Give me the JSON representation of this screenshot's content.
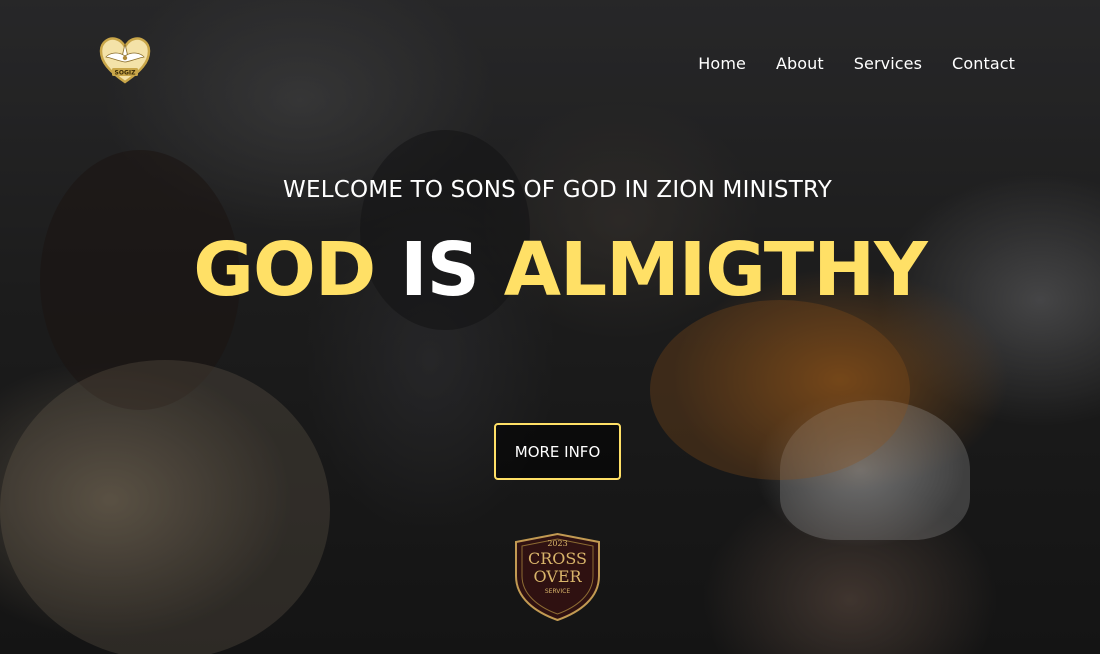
{
  "brand": {
    "logo_text": "SOGIZ",
    "logo_icon": "dove-heart-icon",
    "accent_color": "#ffe066"
  },
  "nav": {
    "items": [
      {
        "label": "Home"
      },
      {
        "label": "About"
      },
      {
        "label": "Services"
      },
      {
        "label": "Contact"
      }
    ]
  },
  "hero": {
    "welcome_text": "WELCOME TO SONS OF GOD IN ZION MINISTRY",
    "headline": {
      "word1": "GOD",
      "word2": "IS",
      "word3": "ALMIGTHY"
    },
    "cta_label": "MORE INFO"
  },
  "badge": {
    "top_text": "2023",
    "line1": "CROSS",
    "line2": "OVER",
    "line3": "SERVICE"
  }
}
